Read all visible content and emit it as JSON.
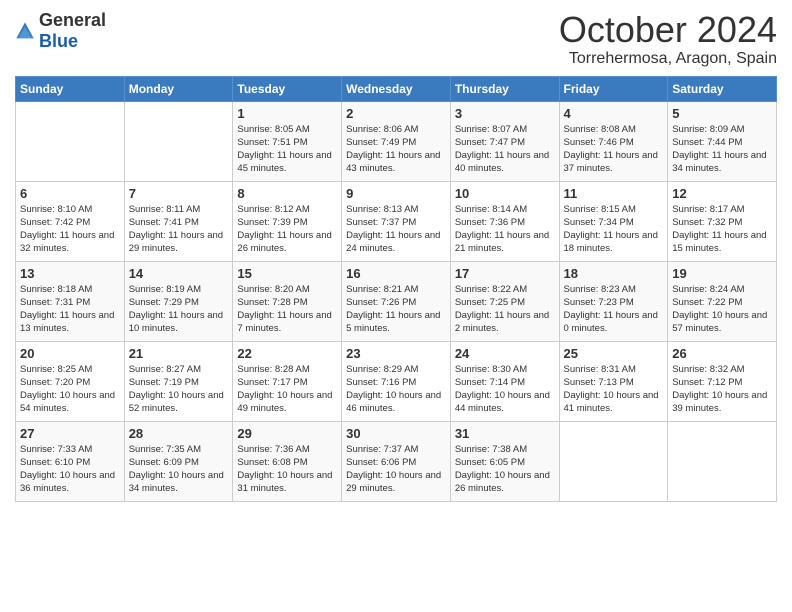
{
  "logo": {
    "general": "General",
    "blue": "Blue"
  },
  "header": {
    "month": "October 2024",
    "location": "Torrehermosa, Aragon, Spain"
  },
  "weekdays": [
    "Sunday",
    "Monday",
    "Tuesday",
    "Wednesday",
    "Thursday",
    "Friday",
    "Saturday"
  ],
  "weeks": [
    [
      {
        "day": "",
        "sunrise": "",
        "sunset": "",
        "daylight": ""
      },
      {
        "day": "",
        "sunrise": "",
        "sunset": "",
        "daylight": ""
      },
      {
        "day": "1",
        "sunrise": "Sunrise: 8:05 AM",
        "sunset": "Sunset: 7:51 PM",
        "daylight": "Daylight: 11 hours and 45 minutes."
      },
      {
        "day": "2",
        "sunrise": "Sunrise: 8:06 AM",
        "sunset": "Sunset: 7:49 PM",
        "daylight": "Daylight: 11 hours and 43 minutes."
      },
      {
        "day": "3",
        "sunrise": "Sunrise: 8:07 AM",
        "sunset": "Sunset: 7:47 PM",
        "daylight": "Daylight: 11 hours and 40 minutes."
      },
      {
        "day": "4",
        "sunrise": "Sunrise: 8:08 AM",
        "sunset": "Sunset: 7:46 PM",
        "daylight": "Daylight: 11 hours and 37 minutes."
      },
      {
        "day": "5",
        "sunrise": "Sunrise: 8:09 AM",
        "sunset": "Sunset: 7:44 PM",
        "daylight": "Daylight: 11 hours and 34 minutes."
      }
    ],
    [
      {
        "day": "6",
        "sunrise": "Sunrise: 8:10 AM",
        "sunset": "Sunset: 7:42 PM",
        "daylight": "Daylight: 11 hours and 32 minutes."
      },
      {
        "day": "7",
        "sunrise": "Sunrise: 8:11 AM",
        "sunset": "Sunset: 7:41 PM",
        "daylight": "Daylight: 11 hours and 29 minutes."
      },
      {
        "day": "8",
        "sunrise": "Sunrise: 8:12 AM",
        "sunset": "Sunset: 7:39 PM",
        "daylight": "Daylight: 11 hours and 26 minutes."
      },
      {
        "day": "9",
        "sunrise": "Sunrise: 8:13 AM",
        "sunset": "Sunset: 7:37 PM",
        "daylight": "Daylight: 11 hours and 24 minutes."
      },
      {
        "day": "10",
        "sunrise": "Sunrise: 8:14 AM",
        "sunset": "Sunset: 7:36 PM",
        "daylight": "Daylight: 11 hours and 21 minutes."
      },
      {
        "day": "11",
        "sunrise": "Sunrise: 8:15 AM",
        "sunset": "Sunset: 7:34 PM",
        "daylight": "Daylight: 11 hours and 18 minutes."
      },
      {
        "day": "12",
        "sunrise": "Sunrise: 8:17 AM",
        "sunset": "Sunset: 7:32 PM",
        "daylight": "Daylight: 11 hours and 15 minutes."
      }
    ],
    [
      {
        "day": "13",
        "sunrise": "Sunrise: 8:18 AM",
        "sunset": "Sunset: 7:31 PM",
        "daylight": "Daylight: 11 hours and 13 minutes."
      },
      {
        "day": "14",
        "sunrise": "Sunrise: 8:19 AM",
        "sunset": "Sunset: 7:29 PM",
        "daylight": "Daylight: 11 hours and 10 minutes."
      },
      {
        "day": "15",
        "sunrise": "Sunrise: 8:20 AM",
        "sunset": "Sunset: 7:28 PM",
        "daylight": "Daylight: 11 hours and 7 minutes."
      },
      {
        "day": "16",
        "sunrise": "Sunrise: 8:21 AM",
        "sunset": "Sunset: 7:26 PM",
        "daylight": "Daylight: 11 hours and 5 minutes."
      },
      {
        "day": "17",
        "sunrise": "Sunrise: 8:22 AM",
        "sunset": "Sunset: 7:25 PM",
        "daylight": "Daylight: 11 hours and 2 minutes."
      },
      {
        "day": "18",
        "sunrise": "Sunrise: 8:23 AM",
        "sunset": "Sunset: 7:23 PM",
        "daylight": "Daylight: 11 hours and 0 minutes."
      },
      {
        "day": "19",
        "sunrise": "Sunrise: 8:24 AM",
        "sunset": "Sunset: 7:22 PM",
        "daylight": "Daylight: 10 hours and 57 minutes."
      }
    ],
    [
      {
        "day": "20",
        "sunrise": "Sunrise: 8:25 AM",
        "sunset": "Sunset: 7:20 PM",
        "daylight": "Daylight: 10 hours and 54 minutes."
      },
      {
        "day": "21",
        "sunrise": "Sunrise: 8:27 AM",
        "sunset": "Sunset: 7:19 PM",
        "daylight": "Daylight: 10 hours and 52 minutes."
      },
      {
        "day": "22",
        "sunrise": "Sunrise: 8:28 AM",
        "sunset": "Sunset: 7:17 PM",
        "daylight": "Daylight: 10 hours and 49 minutes."
      },
      {
        "day": "23",
        "sunrise": "Sunrise: 8:29 AM",
        "sunset": "Sunset: 7:16 PM",
        "daylight": "Daylight: 10 hours and 46 minutes."
      },
      {
        "day": "24",
        "sunrise": "Sunrise: 8:30 AM",
        "sunset": "Sunset: 7:14 PM",
        "daylight": "Daylight: 10 hours and 44 minutes."
      },
      {
        "day": "25",
        "sunrise": "Sunrise: 8:31 AM",
        "sunset": "Sunset: 7:13 PM",
        "daylight": "Daylight: 10 hours and 41 minutes."
      },
      {
        "day": "26",
        "sunrise": "Sunrise: 8:32 AM",
        "sunset": "Sunset: 7:12 PM",
        "daylight": "Daylight: 10 hours and 39 minutes."
      }
    ],
    [
      {
        "day": "27",
        "sunrise": "Sunrise: 7:33 AM",
        "sunset": "Sunset: 6:10 PM",
        "daylight": "Daylight: 10 hours and 36 minutes."
      },
      {
        "day": "28",
        "sunrise": "Sunrise: 7:35 AM",
        "sunset": "Sunset: 6:09 PM",
        "daylight": "Daylight: 10 hours and 34 minutes."
      },
      {
        "day": "29",
        "sunrise": "Sunrise: 7:36 AM",
        "sunset": "Sunset: 6:08 PM",
        "daylight": "Daylight: 10 hours and 31 minutes."
      },
      {
        "day": "30",
        "sunrise": "Sunrise: 7:37 AM",
        "sunset": "Sunset: 6:06 PM",
        "daylight": "Daylight: 10 hours and 29 minutes."
      },
      {
        "day": "31",
        "sunrise": "Sunrise: 7:38 AM",
        "sunset": "Sunset: 6:05 PM",
        "daylight": "Daylight: 10 hours and 26 minutes."
      },
      {
        "day": "",
        "sunrise": "",
        "sunset": "",
        "daylight": ""
      },
      {
        "day": "",
        "sunrise": "",
        "sunset": "",
        "daylight": ""
      }
    ]
  ]
}
